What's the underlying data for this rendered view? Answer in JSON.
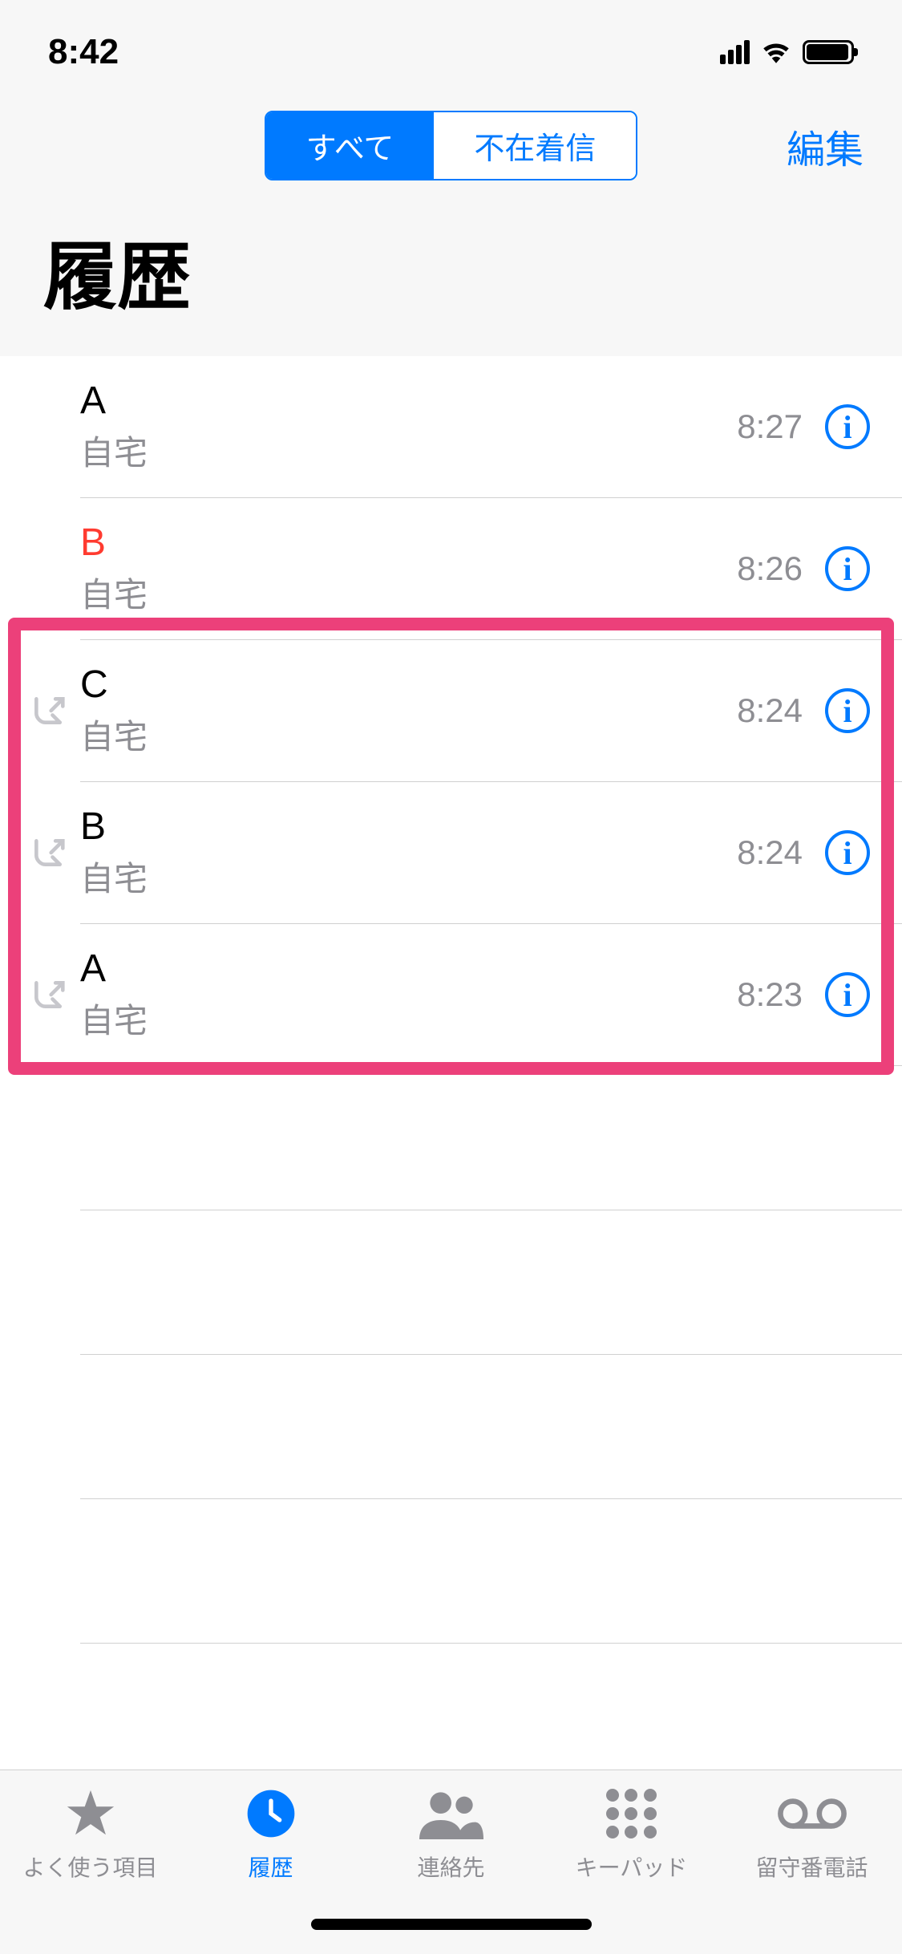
{
  "status": {
    "time": "8:42"
  },
  "header": {
    "segments": {
      "all": "すべて",
      "missed": "不在着信"
    },
    "edit": "編集",
    "title": "履歴"
  },
  "calls": [
    {
      "name": "A",
      "label": "自宅",
      "time": "8:27",
      "missed": false,
      "outgoing": false
    },
    {
      "name": "B",
      "label": "自宅",
      "time": "8:26",
      "missed": true,
      "outgoing": false
    },
    {
      "name": "C",
      "label": "自宅",
      "time": "8:24",
      "missed": false,
      "outgoing": true
    },
    {
      "name": "B",
      "label": "自宅",
      "time": "8:24",
      "missed": false,
      "outgoing": true
    },
    {
      "name": "A",
      "label": "自宅",
      "time": "8:23",
      "missed": false,
      "outgoing": true
    }
  ],
  "tabs": {
    "favorites": "よく使う項目",
    "recents": "履歴",
    "contacts": "連絡先",
    "keypad": "キーパッド",
    "voicemail": "留守番電話"
  }
}
